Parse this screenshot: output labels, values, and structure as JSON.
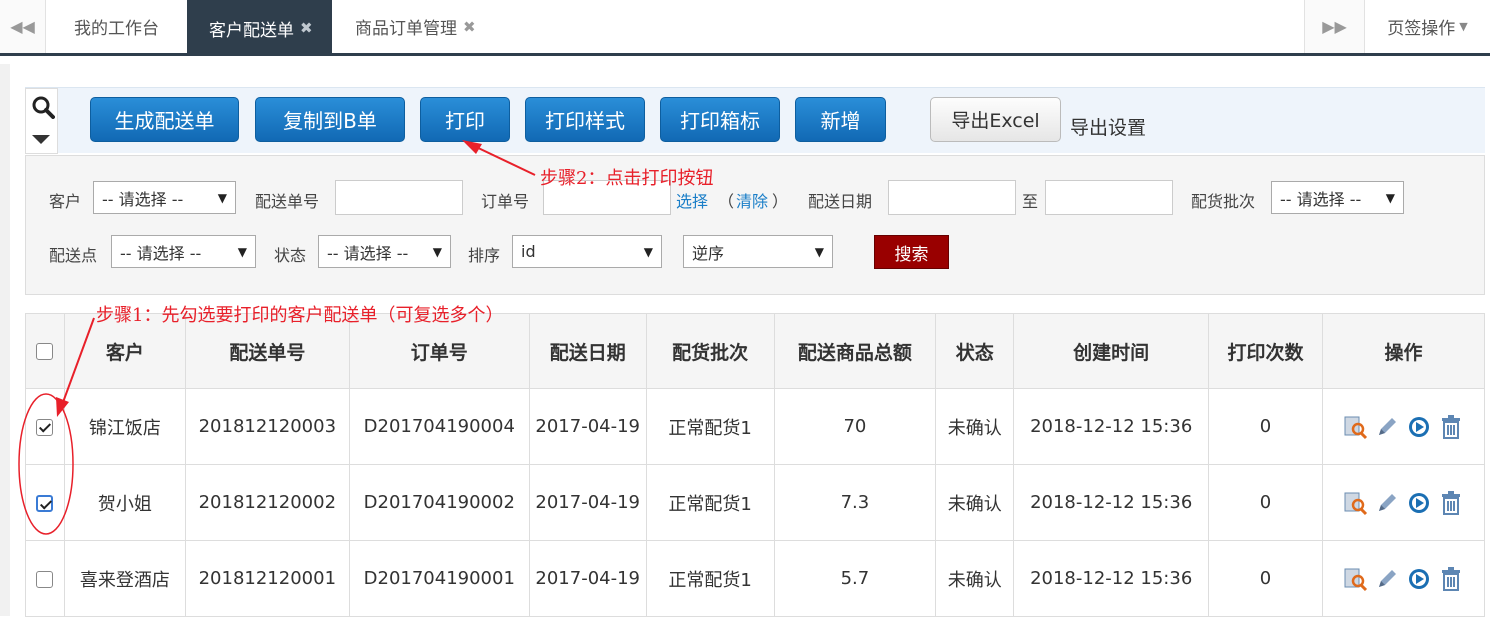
{
  "tabs": {
    "items": [
      {
        "label": "我的工作台"
      },
      {
        "label": "客户配送单"
      },
      {
        "label": "商品订单管理"
      }
    ],
    "ops_label": "页签操作",
    "close_glyph": "✖",
    "prev_icon": "double-chevron-left-icon",
    "next_icon": "double-chevron-right-icon"
  },
  "toolbar": {
    "buttons": [
      {
        "label": "生成配送单"
      },
      {
        "label": "复制到B单"
      },
      {
        "label": "打印"
      },
      {
        "label": "打印样式"
      },
      {
        "label": "打印箱标"
      },
      {
        "label": "新增"
      }
    ],
    "export_excel": "导出Excel",
    "export_settings": "导出设置"
  },
  "search": {
    "customer_label": "客户",
    "customer_value": "-- 请选择 --",
    "delivery_no_label": "配送单号",
    "order_no_label": "订单号",
    "select_link": "选择",
    "clear_link": "清除",
    "clear_open": "（",
    "clear_close": "）",
    "delivery_date_label": "配送日期",
    "to_label": "至",
    "batch_label": "配货批次",
    "batch_value": "-- 请选择 --",
    "point_label": "配送点",
    "point_value": "-- 请选择 --",
    "status_label": "状态",
    "status_value": "-- 请选择 --",
    "sort_label": "排序",
    "sort_value": "id",
    "order_value": "逆序",
    "search_button": "搜索"
  },
  "annotations": {
    "step1": "步骤1：先勾选要打印的客户配送单（可复选多个）",
    "step2": "步骤2：点击打印按钮"
  },
  "table": {
    "columns": [
      "客户",
      "配送单号",
      "订单号",
      "配送日期",
      "配货批次",
      "配送商品总额",
      "状态",
      "创建时间",
      "打印次数",
      "操作"
    ],
    "rows": [
      {
        "checked": true,
        "customer": "锦江饭店",
        "delivery_no": "201812120003",
        "order_no": "D201704190004",
        "date": "2017-04-19",
        "batch": "正常配货1",
        "amount": "70",
        "status": "未确认",
        "created": "2018-12-12 15:36",
        "prints": "0"
      },
      {
        "checked": true,
        "customer": "贺小姐",
        "delivery_no": "201812120002",
        "order_no": "D201704190002",
        "date": "2017-04-19",
        "batch": "正常配货1",
        "amount": "7.3",
        "status": "未确认",
        "created": "2018-12-12 15:36",
        "prints": "0"
      },
      {
        "checked": false,
        "customer": "喜来登酒店",
        "delivery_no": "201812120001",
        "order_no": "D201704190001",
        "date": "2017-04-19",
        "batch": "正常配货1",
        "amount": "5.7",
        "status": "未确认",
        "created": "2018-12-12 15:36",
        "prints": "0"
      }
    ],
    "row_actions": [
      "view-icon",
      "edit-icon",
      "play-icon",
      "delete-icon"
    ]
  },
  "colors": {
    "primary_button": "#1a7cc9",
    "search_button": "#990000",
    "annotation": "#e8202a",
    "active_tab": "#2f3e4c",
    "link": "#1a7ec8"
  }
}
